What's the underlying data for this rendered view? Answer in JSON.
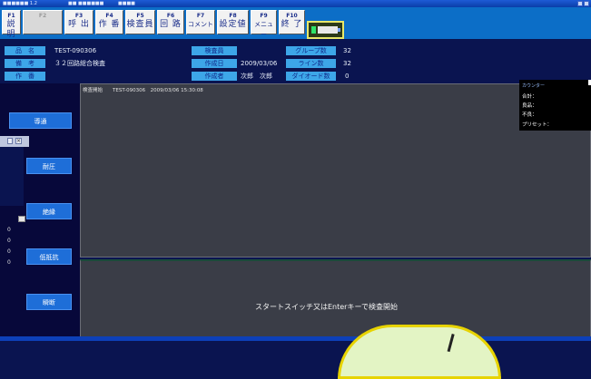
{
  "title_bar": {
    "app": "■■■■■■ 1.2",
    "file": "■■ ■■■■■■",
    "extra": "■■■■"
  },
  "toolbar": {
    "keys": [
      {
        "num": "F1",
        "label": "説 明",
        "disabled": false
      },
      {
        "num": "F2",
        "label": "",
        "disabled": true
      },
      {
        "num": "F3",
        "label": "呼 出",
        "disabled": false
      },
      {
        "num": "F4",
        "label": "作 番",
        "disabled": false
      },
      {
        "num": "F5",
        "label": "検査員",
        "disabled": false
      },
      {
        "num": "F6",
        "label": "回 路",
        "disabled": false
      },
      {
        "num": "F7",
        "label": "コメント",
        "disabled": false
      },
      {
        "num": "F8",
        "label": "設定値",
        "disabled": false
      },
      {
        "num": "F9",
        "label": "メニュー",
        "disabled": false
      },
      {
        "num": "F10",
        "label": "終 了",
        "disabled": false
      }
    ]
  },
  "info": {
    "hinmei_label": "品　名",
    "hinmei_value": "TEST-090306",
    "bikou_label": "備　考",
    "bikou_value": "３２回路総合検査",
    "sakuban_label": "作　番",
    "sakuban_value": "",
    "kensain_label": "検査員",
    "kensain_value": "",
    "sakuseibi_label": "作成日",
    "sakuseibi_value": "2009/03/06",
    "sakuseisha_label": "作成者",
    "sakuseisha_value": "次郎　次郎",
    "group_label": "グループ数",
    "group_value": "32",
    "line_label": "ライン数",
    "line_value": "32",
    "diode_label": "ダイオード数",
    "diode_value": "0"
  },
  "sidebar": {
    "items": [
      {
        "label": "導通"
      },
      {
        "label": "耐圧"
      },
      {
        "label": "絶縁"
      },
      {
        "label": "低抵抗"
      },
      {
        "label": "瞬断"
      }
    ]
  },
  "floating": {
    "values": [
      "0",
      "0",
      "0",
      "0"
    ]
  },
  "main": {
    "status_header": "検査開始　　TEST-090306　2009/03/06 15:30:08",
    "prompt": "スタートスイッチ又はEnterキーで検査開始"
  },
  "counter": {
    "title": "カウンター",
    "total": "合計：",
    "good": "良品：",
    "bad": "不良：",
    "preset": "プリセット："
  }
}
